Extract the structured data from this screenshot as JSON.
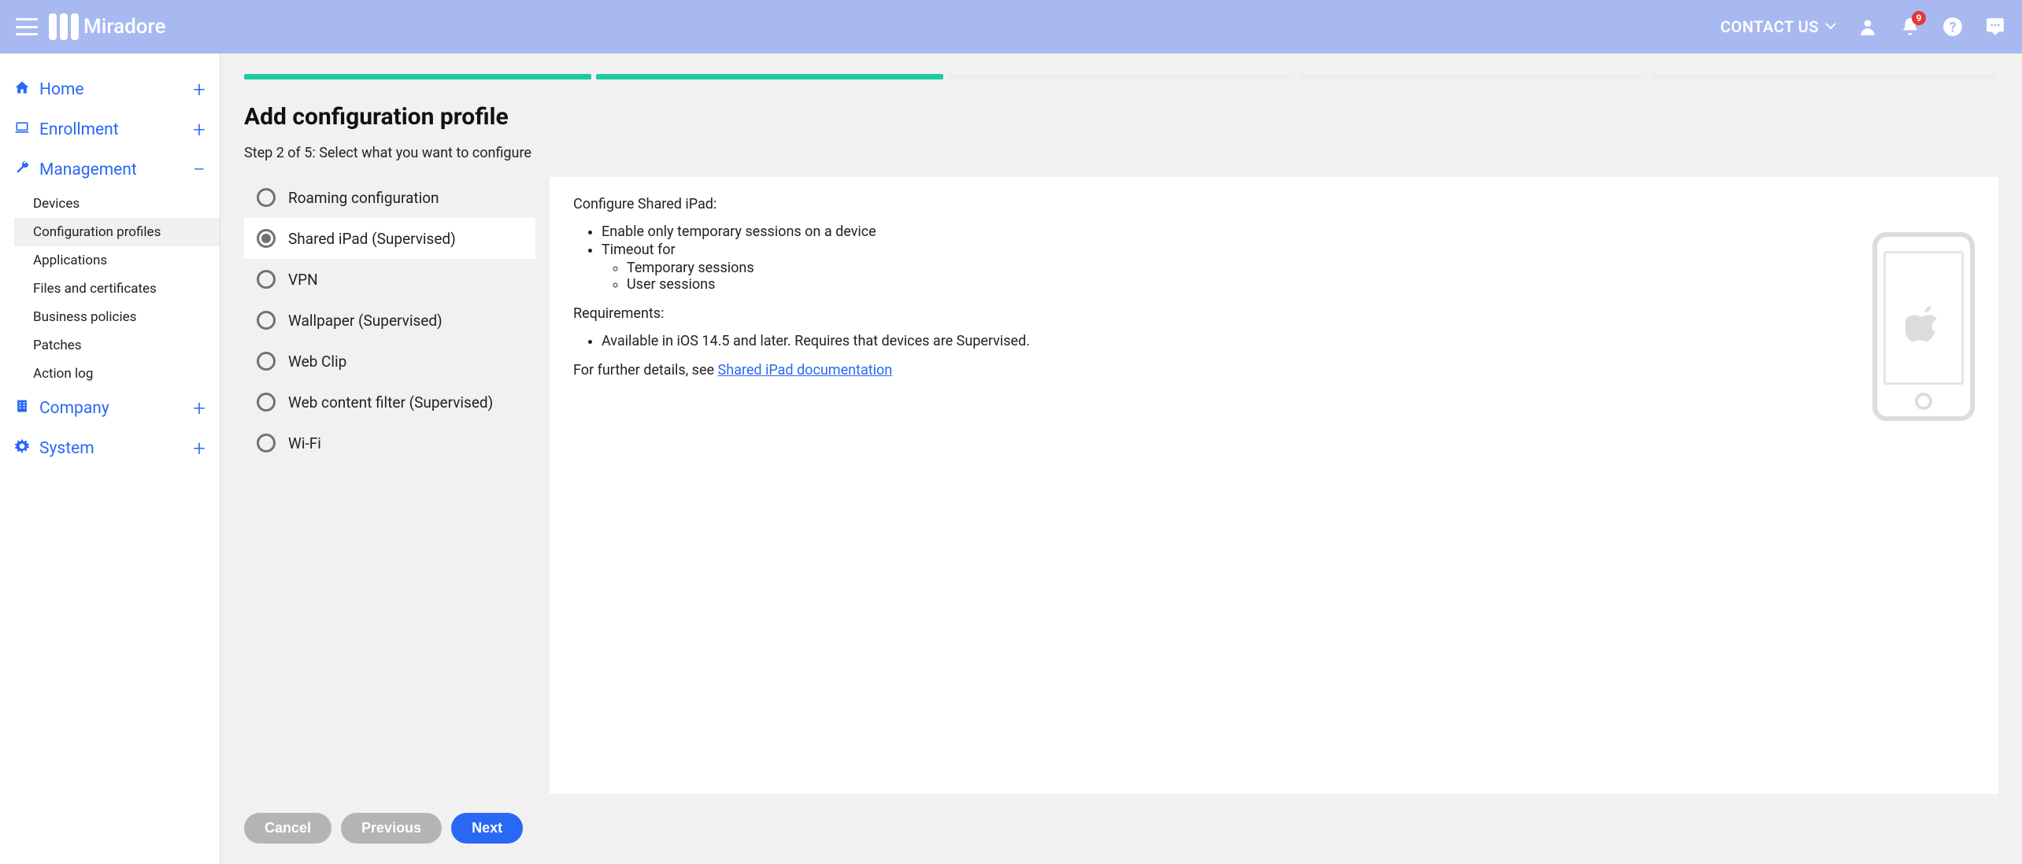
{
  "brand": "Miradore",
  "header": {
    "contact_us": "CONTACT US",
    "notification_count": "9"
  },
  "sidebar": {
    "items": [
      {
        "label": "Home",
        "icon": "home",
        "action": "plus"
      },
      {
        "label": "Enrollment",
        "icon": "laptop",
        "action": "plus"
      },
      {
        "label": "Management",
        "icon": "wrench",
        "action": "minus",
        "subitems": [
          {
            "label": "Devices"
          },
          {
            "label": "Configuration profiles",
            "active": true
          },
          {
            "label": "Applications"
          },
          {
            "label": "Files and certificates"
          },
          {
            "label": "Business policies"
          },
          {
            "label": "Patches"
          },
          {
            "label": "Action log"
          }
        ]
      },
      {
        "label": "Company",
        "icon": "building",
        "action": "plus"
      },
      {
        "label": "System",
        "icon": "gear",
        "action": "plus"
      }
    ]
  },
  "page": {
    "title": "Add configuration profile",
    "step_label": "Step 2 of 5: Select what you want to configure",
    "progress_total": 5,
    "progress_done": 2
  },
  "options": [
    {
      "label": "Roaming configuration",
      "selected": false
    },
    {
      "label": "Shared iPad (Supervised)",
      "selected": true
    },
    {
      "label": "VPN",
      "selected": false
    },
    {
      "label": "Wallpaper (Supervised)",
      "selected": false
    },
    {
      "label": "Web Clip",
      "selected": false
    },
    {
      "label": "Web content filter (Supervised)",
      "selected": false
    },
    {
      "label": "Wi-Fi",
      "selected": false
    }
  ],
  "detail": {
    "heading": "Configure Shared iPad:",
    "bullets": [
      "Enable only temporary sessions on a device",
      "Timeout for"
    ],
    "bullets_sub": [
      "Temporary sessions",
      "User sessions"
    ],
    "req_heading": "Requirements:",
    "req_bullets": [
      "Available in iOS 14.5 and later. Requires that devices are Supervised."
    ],
    "more_prefix": "For further details, see ",
    "more_link": "Shared iPad documentation"
  },
  "buttons": {
    "cancel": "Cancel",
    "previous": "Previous",
    "next": "Next"
  }
}
